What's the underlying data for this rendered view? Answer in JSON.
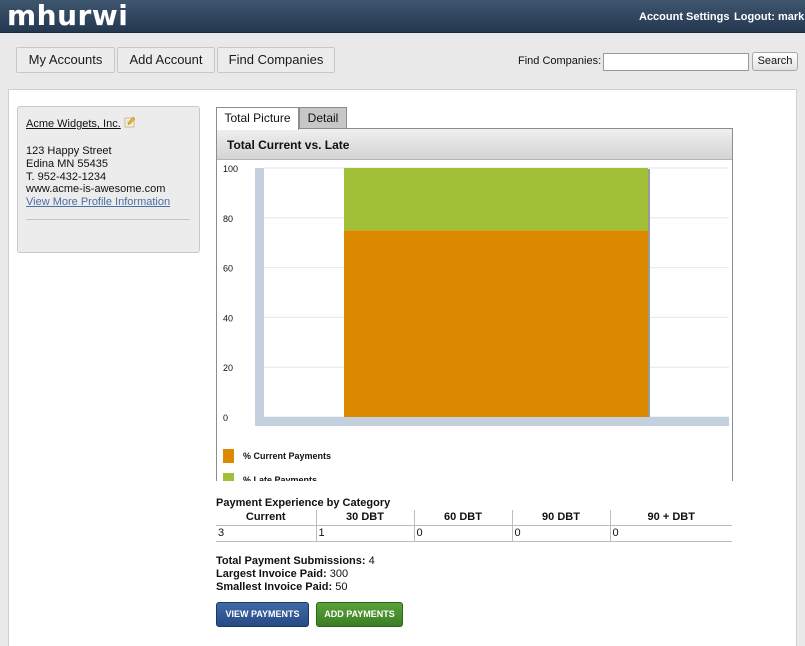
{
  "header": {
    "logo": "mhurwi",
    "account_settings": "Account Settings",
    "logout": "Logout: mark"
  },
  "nav": {
    "my_accounts": "My Accounts",
    "add_account": "Add Account",
    "find_companies": "Find Companies"
  },
  "search": {
    "label": "Find Companies:",
    "value": "",
    "button": "Search"
  },
  "profile": {
    "company_name": "Acme Widgets, Inc.",
    "street": "123 Happy Street",
    "city_state_zip": "Edina MN 55435",
    "phone": "T. 952-432-1234",
    "website": "www.acme-is-awesome.com",
    "more_link": "View More Profile Information"
  },
  "tabs": {
    "total_picture": "Total Picture",
    "detail": "Detail"
  },
  "chart_data": {
    "type": "bar",
    "title": "Total Current vs. Late",
    "stacked": true,
    "categories": [
      ""
    ],
    "series": [
      {
        "name": "% Current Payments",
        "values": [
          75
        ],
        "color": "#db8a00"
      },
      {
        "name": "% Late Payments",
        "values": [
          25
        ],
        "color": "#a2c037"
      }
    ],
    "ylim": [
      0,
      100
    ],
    "yticks": [
      0,
      20,
      40,
      60,
      80,
      100
    ],
    "grid": true,
    "legend": "bottom-left"
  },
  "payment_table": {
    "title": "Payment Experience by Category",
    "headers": [
      "Current",
      "30 DBT",
      "60 DBT",
      "90 DBT",
      "90 + DBT"
    ],
    "row": [
      "3",
      "1",
      "0",
      "0",
      "0"
    ]
  },
  "stats": {
    "submissions_label": "Total Payment Submissions:",
    "submissions_value": "4",
    "largest_label": "Largest Invoice Paid:",
    "largest_value": "300",
    "smallest_label": "Smallest Invoice Paid:",
    "smallest_value": "50"
  },
  "actions": {
    "view_payments": "VIEW PAYMENTS",
    "add_payments": "ADD PAYMENTS"
  }
}
